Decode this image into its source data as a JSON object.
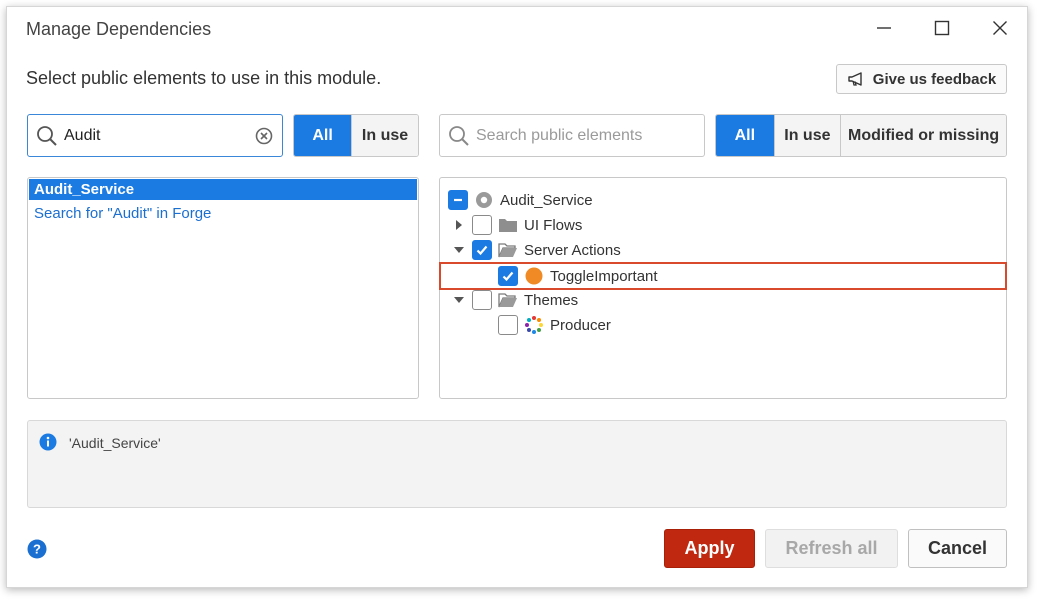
{
  "dialog": {
    "title": "Manage Dependencies",
    "subtitle": "Select public elements to use in this module.",
    "feedback_label": "Give us feedback"
  },
  "left_search": {
    "value": "Audit",
    "placeholder": ""
  },
  "left_filters": [
    {
      "label": "All",
      "active": true
    },
    {
      "label": "In use",
      "active": false
    }
  ],
  "right_search": {
    "value": "",
    "placeholder": "Search public elements"
  },
  "right_filters": [
    {
      "label": "All",
      "active": true
    },
    {
      "label": "In use",
      "active": false
    },
    {
      "label": "Modified or missing",
      "active": false
    }
  ],
  "module_list": {
    "selected": "Audit_Service",
    "forge_link": "Search for \"Audit\" in Forge"
  },
  "tree": [
    {
      "label": "Audit_Service",
      "checkbox": "partial",
      "icon": "module-icon",
      "expander": "none"
    },
    {
      "label": "UI Flows",
      "checkbox": "unchecked",
      "icon": "folder-icon",
      "expander": "collapsed"
    },
    {
      "label": "Server Actions",
      "checkbox": "checked",
      "icon": "folder-open-icon",
      "expander": "expanded"
    },
    {
      "label": "ToggleImportant",
      "checkbox": "checked",
      "icon": "server-action-icon",
      "expander": "none",
      "highlighted": true
    },
    {
      "label": "Themes",
      "checkbox": "unchecked",
      "icon": "folder-open-icon",
      "expander": "expanded"
    },
    {
      "label": "Producer",
      "checkbox": "unchecked",
      "icon": "theme-icon",
      "expander": "none"
    }
  ],
  "info": {
    "text": "'Audit_Service'"
  },
  "buttons": {
    "apply": "Apply",
    "refresh": "Refresh all",
    "cancel": "Cancel"
  },
  "colors": {
    "accent": "#1b7be2",
    "apply": "#c0280f",
    "highlight_border": "#d84a2b",
    "server_action": "#ef8a24"
  }
}
